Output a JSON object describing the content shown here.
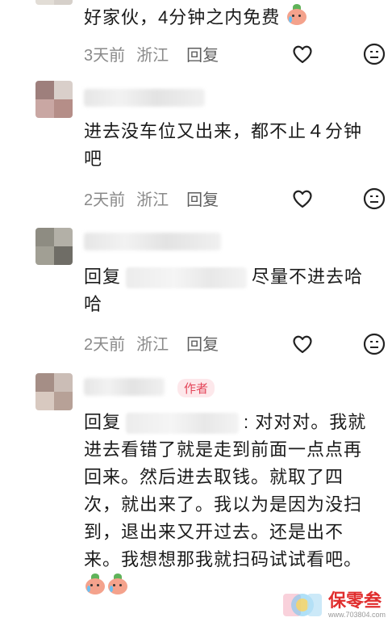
{
  "comments": [
    {
      "id": 1,
      "text": "好家伙，4分钟之内免费",
      "time": "3天前",
      "location": "浙江",
      "reply_label": "回复",
      "has_emoji": true
    },
    {
      "id": 2,
      "text": "进去没车位又出来，都不止４分钟吧",
      "time": "2天前",
      "location": "浙江",
      "reply_label": "回复"
    },
    {
      "id": 3,
      "reply_prefix": "回复",
      "text_after": "尽量不进去哈哈",
      "time": "2天前",
      "location": "浙江",
      "reply_label": "回复"
    },
    {
      "id": 4,
      "author_tag": "作者",
      "reply_prefix": "回复",
      "text_after": ": 对对对。我就进去看错了就是走到前面一点点再回来。然后进去取钱。就取了四次，就出来了。我以为是因为没扫到，退出来又开过去。还是出不来。我想想那我就扫码试试看吧。"
    }
  ],
  "icons": {
    "like": "heart-outline-icon",
    "reaction": "smiley-icon",
    "emoji": "crying-peach-emoji-icon"
  },
  "watermark": {
    "text": "保零叁",
    "url": "www.703804.com"
  },
  "colors": {
    "meta": "#8a8a8a",
    "author_tag": "#e4465a",
    "author_tag_bg": "#fde8eb",
    "watermark": "#e02d2d"
  }
}
